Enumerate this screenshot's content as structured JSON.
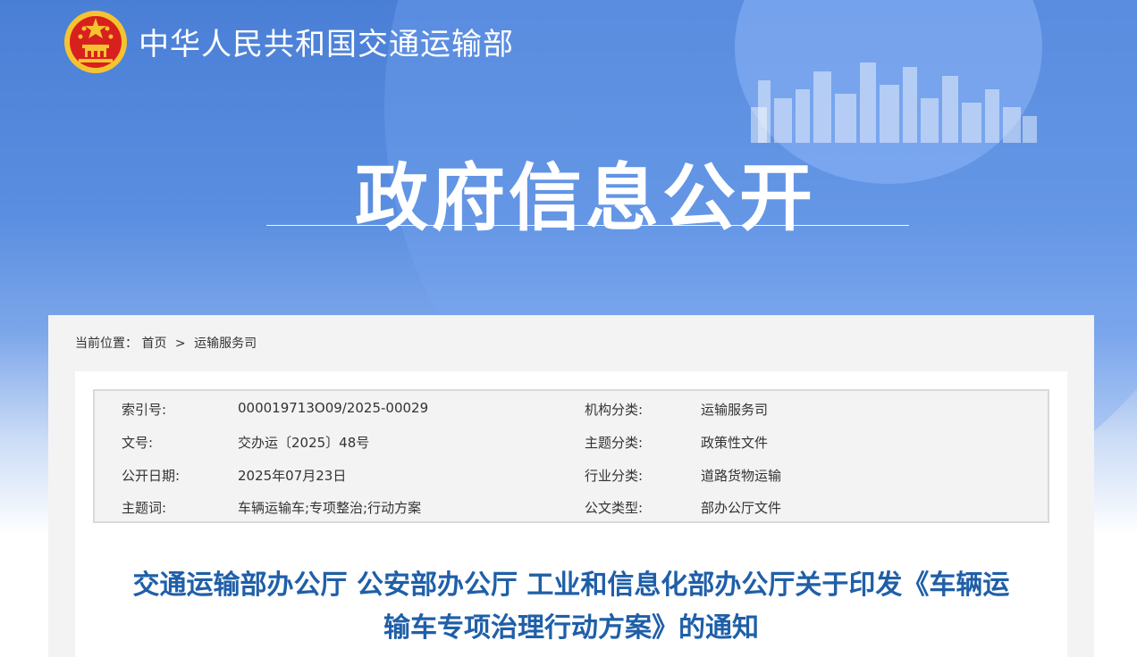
{
  "header": {
    "site_title": "中华人民共和国交通运输部",
    "hero_title": "政府信息公开"
  },
  "breadcrumb": {
    "label": "当前位置：",
    "home": "首页",
    "separator": ">",
    "current": "运输服务司"
  },
  "meta": {
    "rows": [
      {
        "k1": "索引号:",
        "v1": "000019713O09/2025-00029",
        "k2": "机构分类:",
        "v2": "运输服务司"
      },
      {
        "k1": "文号:",
        "v1": "交办运〔2025〕48号",
        "k2": "主题分类:",
        "v2": "政策性文件"
      },
      {
        "k1": "公开日期:",
        "v1": "2025年07月23日",
        "k2": "行业分类:",
        "v2": "道路货物运输"
      },
      {
        "k1": "主题词:",
        "v1": "车辆运输车;专项整治;行动方案",
        "k2": "公文类型:",
        "v2": "部办公厅文件"
      }
    ]
  },
  "document": {
    "title_line1": "交通运输部办公厅 公安部办公厅 工业和信息化部办公厅关于印发《车辆运",
    "title_line2": "输车专项治理行动方案》的通知"
  },
  "colors": {
    "banner_blue": "#4a7fd6",
    "title_blue": "#1f5fa8",
    "emblem_red": "#d8201e",
    "emblem_gold": "#f4c430"
  },
  "icons": {
    "emblem": "national-emblem-icon",
    "skyline": "city-skyline-illustration"
  }
}
